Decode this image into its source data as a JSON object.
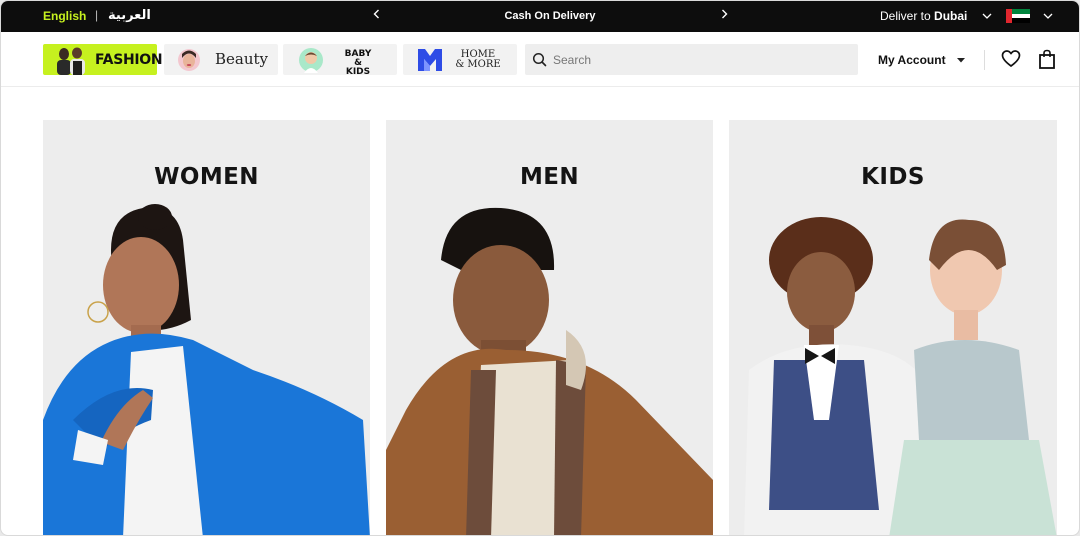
{
  "topbar": {
    "lang_english": "English",
    "lang_separator": "|",
    "lang_arabic": "العربية",
    "promo_text": "Cash On Delivery",
    "deliver_prefix": "Deliver to",
    "deliver_city": "Dubai",
    "icons": {
      "prev": "chevron-left-icon",
      "next": "chevron-right-icon",
      "location_dropdown": "chevron-down-icon",
      "flag": "uae-flag-icon",
      "country_dropdown": "chevron-down-icon"
    }
  },
  "header": {
    "stores": [
      {
        "label": "FASHION",
        "active": true
      },
      {
        "label": "Beauty",
        "active": false
      },
      {
        "label_line1": "BABY",
        "label_line2": "& KIDS",
        "active": false
      },
      {
        "label_line1": "HOME",
        "label_line2": "& MORE",
        "active": false
      }
    ],
    "search": {
      "placeholder": "Search",
      "value": ""
    },
    "account_label": "My Account",
    "icons": {
      "search": "search-icon",
      "account_dropdown": "caret-down-icon",
      "wishlist": "heart-icon",
      "bag": "shopping-bag-icon"
    }
  },
  "categories": [
    {
      "title": "WOMEN"
    },
    {
      "title": "MEN"
    },
    {
      "title": "KIDS"
    }
  ],
  "colors": {
    "accent_lime": "#c6f11f",
    "topbar_bg": "#0d0d0d",
    "card_bg": "#ededed",
    "home_logo_blue": "#2e4ce6"
  }
}
